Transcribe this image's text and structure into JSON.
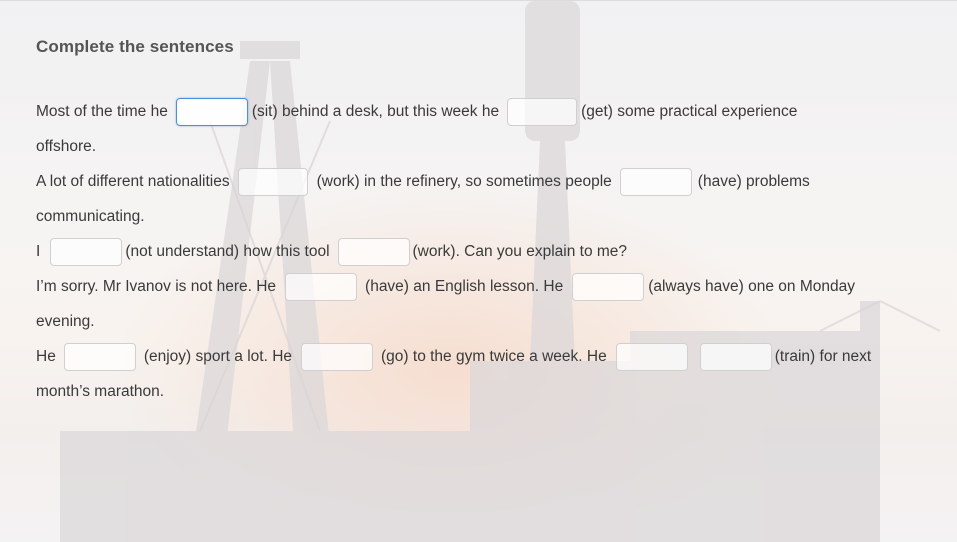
{
  "title": "Complete the sentences",
  "lines": [
    {
      "t1": "Most of the time he",
      "t2": "(sit) behind a desk, but this week he",
      "t3": "(get) some practical experience"
    },
    {
      "t1": "offshore."
    },
    {
      "t1": "A lot of different nationalities",
      "t2": "(work) in the refinery, so sometimes people",
      "t3": "(have) problems"
    },
    {
      "t1": "communicating."
    },
    {
      "t1": "I",
      "t2": "(not understand) how this tool",
      "t3": "(work). Can you explain to me?"
    },
    {
      "t1": "I’m sorry. Mr Ivanov is not here. He",
      "t2": "(have) an English lesson. He",
      "t3": "(always have) one on Monday"
    },
    {
      "t1": "evening."
    },
    {
      "t1": "He",
      "t2": "(enjoy) sport a lot. He",
      "t3": "(go) to the gym twice a week. He",
      "t4": "(train) for next"
    },
    {
      "t1": "month’s marathon."
    }
  ]
}
